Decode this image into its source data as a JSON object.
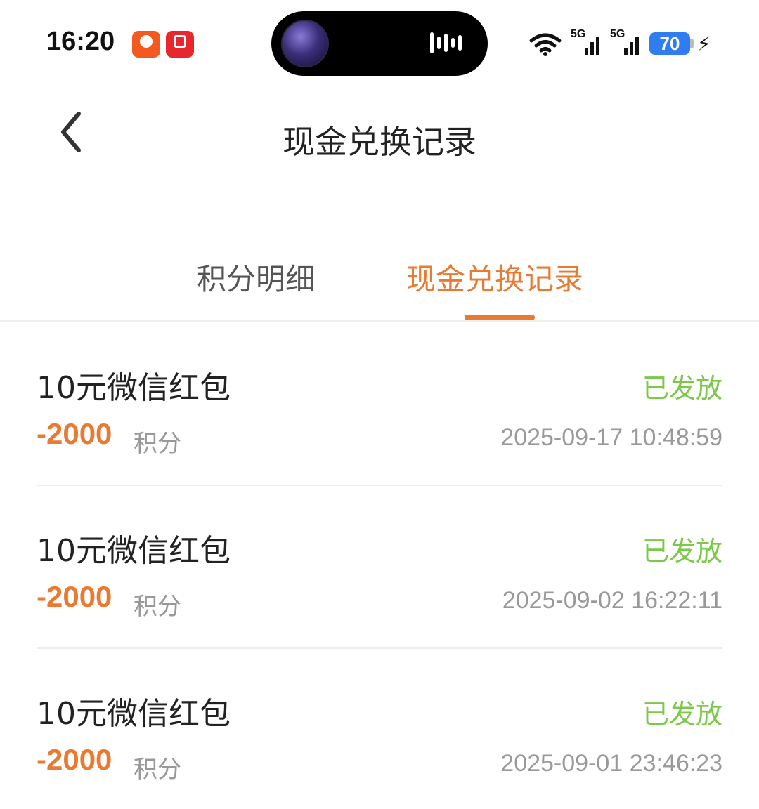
{
  "status_bar": {
    "time": "16:20",
    "network_1": "5G",
    "network_2": "5G",
    "battery": "70"
  },
  "header": {
    "title": "现金兑换记录",
    "back_icon": "chevron-left-icon"
  },
  "tabs": [
    {
      "label": "积分明细",
      "active": false
    },
    {
      "label": "现金兑换记录",
      "active": true
    }
  ],
  "records": [
    {
      "title": "10元微信红包",
      "status": "已发放",
      "points": "-2000",
      "unit": "积分",
      "time": "2025-09-17 10:48:59"
    },
    {
      "title": "10元微信红包",
      "status": "已发放",
      "points": "-2000",
      "unit": "积分",
      "time": "2025-09-02 16:22:11"
    },
    {
      "title": "10元微信红包",
      "status": "已发放",
      "points": "-2000",
      "unit": "积分",
      "time": "2025-09-01 23:46:23"
    }
  ],
  "colors": {
    "accent": "#e87a32",
    "status_done": "#7cc84a",
    "muted": "#999999"
  }
}
